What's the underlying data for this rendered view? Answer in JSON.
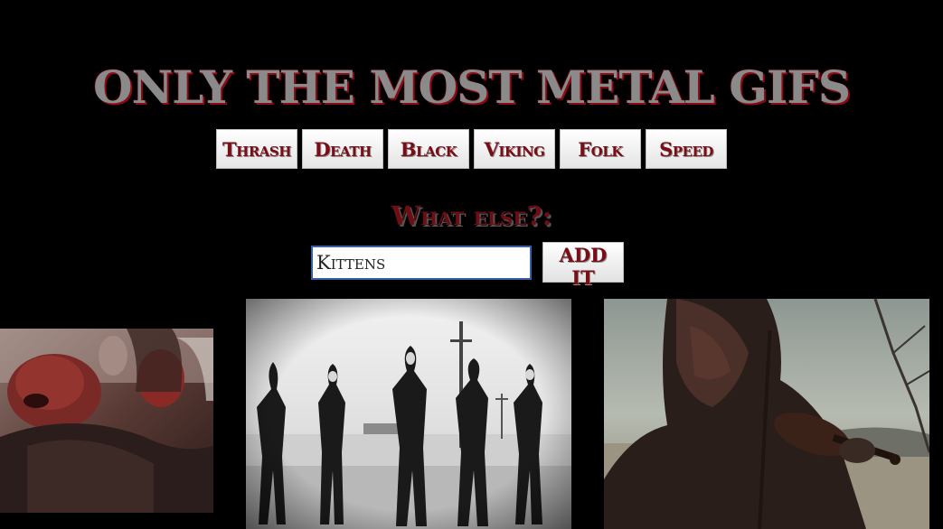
{
  "header": {
    "title": "Only the most metal gifs"
  },
  "genres": {
    "buttons": [
      "Thrash",
      "Death",
      "Black",
      "Viking",
      "Folk",
      "Speed"
    ]
  },
  "add_form": {
    "prompt": "What else?:",
    "input_value": "Kittens",
    "submit_label": "Add it"
  },
  "theme": {
    "background": "#000000",
    "accent": "#7a0d16",
    "title_gray": "#8a8a8a"
  },
  "gifs": [
    {
      "description_icon": "gif-image"
    },
    {
      "description_icon": "gif-image"
    },
    {
      "description_icon": "gif-image"
    }
  ]
}
